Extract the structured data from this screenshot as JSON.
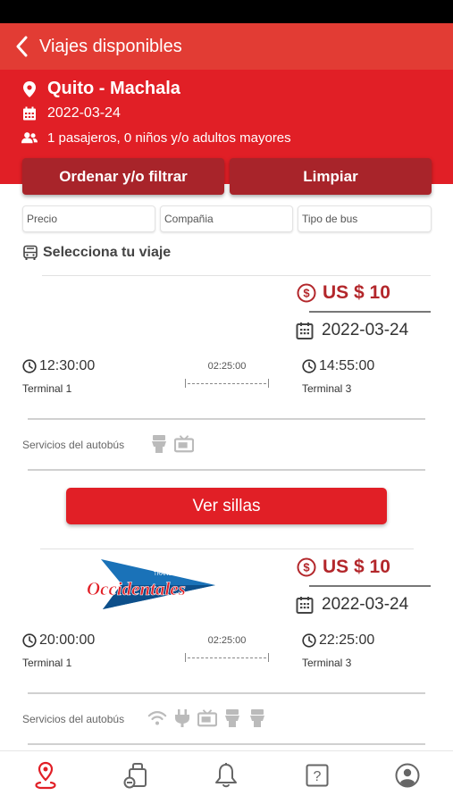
{
  "header": {
    "title": "Viajes disponibles",
    "route": "Quito - Machala",
    "date": "2022-03-24",
    "passengers": "1 pasajeros, 0 niños y/o adultos mayores"
  },
  "actions": {
    "sort_filter": "Ordenar y/o filtrar",
    "clear": "Limpiar"
  },
  "filters": {
    "price": "Precio",
    "company": "Compañia",
    "bus_type": "Tipo de bus"
  },
  "section_title": "Selecciona tu viaje",
  "trips": [
    {
      "company_logo": "",
      "price": "US $ 10",
      "date": "2022-03-24",
      "departure_time": "12:30:00",
      "departure_terminal": "Terminal 1",
      "duration": "02:25:00",
      "arrival_time": "14:55:00",
      "arrival_terminal": "Terminal 3",
      "services_label": "Servicios del autobús",
      "services": [
        "toilet-icon",
        "tv-icon"
      ],
      "seats_button": "Ver sillas"
    },
    {
      "company_logo": "Occidentales",
      "company_logo_top": "TRANSPORTES",
      "price": "US $ 10",
      "date": "2022-03-24",
      "departure_time": "20:00:00",
      "departure_terminal": "Terminal 1",
      "duration": "02:25:00",
      "arrival_time": "22:25:00",
      "arrival_terminal": "Terminal 3",
      "services_label": "Servicios del autobús",
      "services": [
        "wifi-icon",
        "plug-icon",
        "tv-icon",
        "toilet-icon",
        "toilet-icon"
      ]
    }
  ],
  "nav": [
    "route-icon",
    "bag-icon",
    "bell-icon",
    "help-icon",
    "profile-icon"
  ],
  "colors": {
    "header_red": "#e11f26",
    "header_top": "#e23c34",
    "dark_red": "#a8242a",
    "price_red": "#b3272b"
  }
}
